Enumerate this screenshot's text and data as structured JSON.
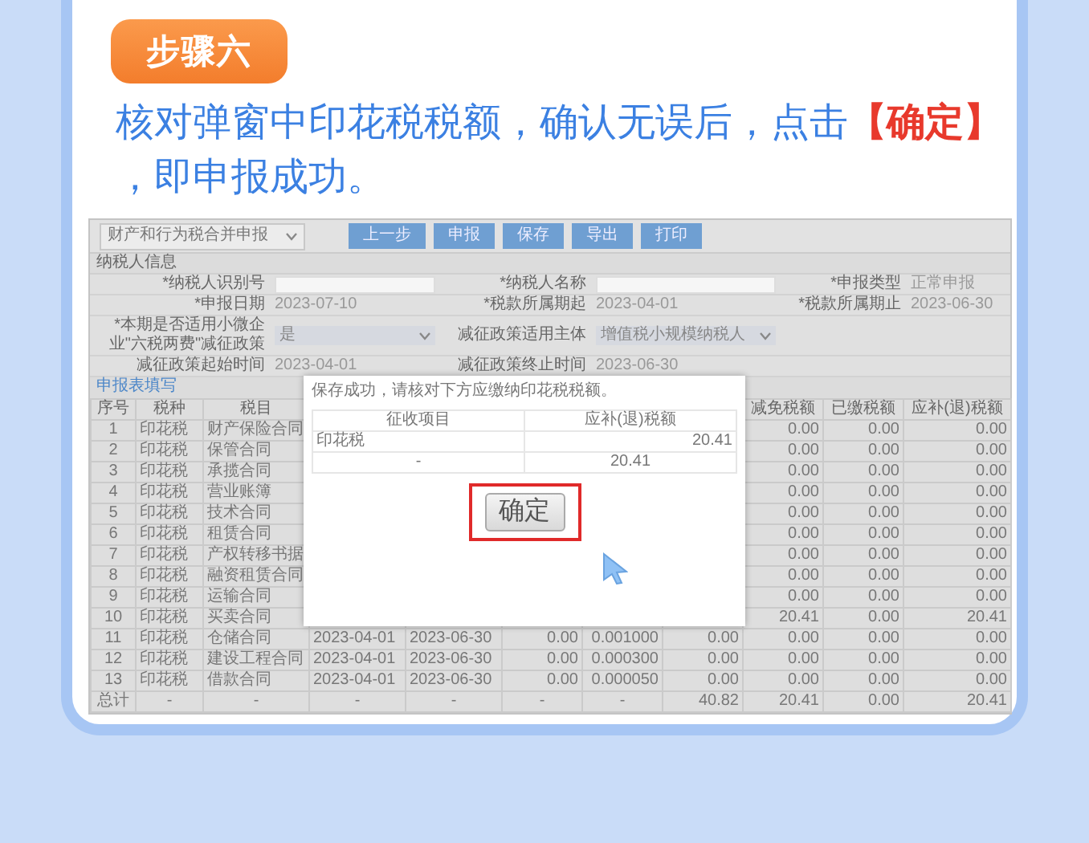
{
  "step": {
    "label": "步骤六"
  },
  "instruction": "核对弹窗中印花税税额，确认无误后，点击**【确定】**，即申报成功。",
  "screen": {
    "form_select": "财产和行为税合并申报",
    "toolbar": [
      "上一步",
      "申报",
      "保存",
      "导出",
      "打印"
    ],
    "section_title": "纳税人信息",
    "form_rows": [
      [
        {
          "label": "*纳税人识别号",
          "kind": "input"
        },
        {
          "label": "*纳税人名称",
          "kind": "input"
        },
        {
          "label": "*申报类型",
          "kind": "text",
          "value": "正常申报"
        }
      ],
      [
        {
          "label": "*申报日期",
          "kind": "text",
          "value": "2023-07-10"
        },
        {
          "label": "*税款所属期起",
          "kind": "text",
          "value": "2023-04-01"
        },
        {
          "label": "*税款所属期止",
          "kind": "text",
          "value": "2023-06-30"
        }
      ],
      [
        {
          "label": "*本期是否适用小微企业\"六税两费\"减征政策",
          "kind": "select",
          "value": "是"
        },
        {
          "label": "减征政策适用主体",
          "kind": "select",
          "value": "增值税小规模纳税人"
        }
      ],
      [
        {
          "label": "减征政策起始时间",
          "kind": "text",
          "value": "2023-04-01"
        },
        {
          "label": "减征政策终止时间",
          "kind": "text",
          "value": "2023-06-30"
        }
      ]
    ],
    "link": "申报表填写",
    "table": {
      "columns": [
        "序号",
        "税种",
        "税目",
        null,
        null,
        null,
        null,
        null,
        "减免税额",
        "已缴税额",
        "应补(退)税额"
      ],
      "rows": [
        [
          "1",
          "印花税",
          "财产保险合同",
          null,
          null,
          null,
          null,
          null,
          "0.00",
          "0.00",
          "0.00"
        ],
        [
          "2",
          "印花税",
          "保管合同",
          null,
          null,
          null,
          null,
          null,
          "0.00",
          "0.00",
          "0.00"
        ],
        [
          "3",
          "印花税",
          "承揽合同",
          null,
          null,
          null,
          null,
          null,
          "0.00",
          "0.00",
          "0.00"
        ],
        [
          "4",
          "印花税",
          "营业账簿",
          null,
          null,
          null,
          null,
          null,
          "0.00",
          "0.00",
          "0.00"
        ],
        [
          "5",
          "印花税",
          "技术合同",
          null,
          null,
          null,
          null,
          null,
          "0.00",
          "0.00",
          "0.00"
        ],
        [
          "6",
          "印花税",
          "租赁合同",
          null,
          null,
          null,
          null,
          null,
          "0.00",
          "0.00",
          "0.00"
        ],
        [
          "7",
          "印花税",
          "产权转移书据",
          null,
          null,
          null,
          null,
          null,
          "0.00",
          "0.00",
          "0.00"
        ],
        [
          "8",
          "印花税",
          "融资租赁合同",
          null,
          null,
          null,
          null,
          null,
          "0.00",
          "0.00",
          "0.00"
        ],
        [
          "9",
          "印花税",
          "运输合同",
          null,
          null,
          null,
          null,
          null,
          "0.00",
          "0.00",
          "0.00"
        ],
        [
          "10",
          "印花税",
          "买卖合同",
          null,
          null,
          null,
          null,
          null,
          "20.41",
          "0.00",
          "20.41"
        ],
        [
          "11",
          "印花税",
          "仓储合同",
          "2023-04-01",
          "2023-06-30",
          "0.00",
          "0.001000",
          "0.00",
          "0.00",
          "0.00",
          "0.00"
        ],
        [
          "12",
          "印花税",
          "建设工程合同",
          "2023-04-01",
          "2023-06-30",
          "0.00",
          "0.000300",
          "0.00",
          "0.00",
          "0.00",
          "0.00"
        ],
        [
          "13",
          "印花税",
          "借款合同",
          "2023-04-01",
          "2023-06-30",
          "0.00",
          "0.000050",
          "0.00",
          "0.00",
          "0.00",
          "0.00"
        ],
        [
          "总计",
          "-",
          "-",
          "-",
          "-",
          "-",
          "-",
          "40.82",
          "20.41",
          "0.00",
          "20.41"
        ]
      ]
    },
    "dialog": {
      "message": "保存成功，请核对下方应缴纳印花税税额。",
      "columns": [
        "征收项目",
        "应补(退)税额"
      ],
      "rows": [
        [
          "印花税",
          "20.41"
        ],
        [
          "-",
          "20.41"
        ]
      ],
      "button": "确定"
    }
  }
}
